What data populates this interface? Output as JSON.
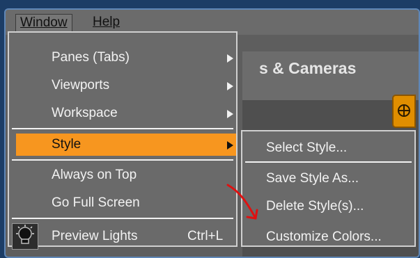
{
  "menubar": {
    "window_label": "Window",
    "help_label": "Help"
  },
  "background_app": {
    "title_fragment": "s & Cameras",
    "tool_icon": "crosshair-icon"
  },
  "window_menu": {
    "items": [
      {
        "label": "Panes (Tabs)",
        "has_submenu": true
      },
      {
        "label": "Viewports",
        "has_submenu": true
      },
      {
        "label": "Workspace",
        "has_submenu": true
      },
      {
        "label": "Style",
        "has_submenu": true,
        "highlighted": true
      },
      {
        "label": "Always on Top",
        "has_submenu": false
      },
      {
        "label": "Go Full Screen",
        "has_submenu": false
      },
      {
        "label": "Preview Lights",
        "shortcut": "Ctrl+L",
        "icon": "lightbulb-icon"
      }
    ]
  },
  "style_submenu": {
    "items": [
      {
        "label": "Select Style..."
      },
      {
        "label": "Save Style As..."
      },
      {
        "label": "Delete Style(s)..."
      },
      {
        "label": "Customize Colors..."
      }
    ]
  },
  "colors": {
    "highlight": "#f7961f",
    "annotation_arrow": "#e01010",
    "menu_background": "#6a6a6a"
  }
}
